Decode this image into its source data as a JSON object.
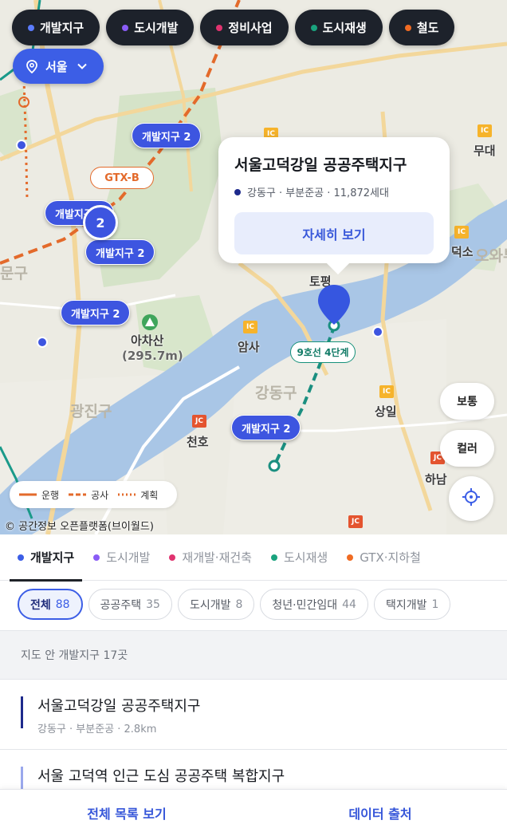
{
  "filter_bar": [
    {
      "label": "개발지구",
      "color": "#5b7cff"
    },
    {
      "label": "도시개발",
      "color": "#8a5cf6"
    },
    {
      "label": "정비사업",
      "color": "#e0336f"
    },
    {
      "label": "도시재생",
      "color": "#1aa37e"
    },
    {
      "label": "철도",
      "color": "#f06b23"
    }
  ],
  "region": {
    "label": "서울"
  },
  "map": {
    "markers": {
      "m1": "개발지구 2",
      "m2": "개발지구 2",
      "m3": "개발지구 2",
      "m4": "개발지구 2",
      "m5": "개발지구 2"
    },
    "cluster_count": "2",
    "gtx_label": "GTX-B",
    "line9_label": "9호선 4단계",
    "place_labels": {
      "mountain": "아차산",
      "mountain_height": "(295.7m)",
      "amsa": "암사",
      "sangil": "상일",
      "cheonho": "천호",
      "hanam": "하남",
      "muddae": "무대",
      "deokso": "덕소",
      "topyeong": "토평",
      "gwangjin": "광진구",
      "gangdong": "강동구",
      "road_right": "오와부",
      "gu_fragment": "문구"
    },
    "ic_labels": {
      "ic": "IC",
      "jc": "JC"
    },
    "legend": [
      {
        "label": "운행",
        "color": "#e36a2b",
        "style": "solid"
      },
      {
        "label": "공사",
        "color": "#e36a2b",
        "style": "dashed"
      },
      {
        "label": "계획",
        "color": "#e36a2b",
        "style": "dotted"
      }
    ],
    "copyright": "© 공간정보 오픈플랫폼(브이월드)",
    "side_buttons": {
      "normal": "보통",
      "color": "컬러"
    }
  },
  "callout": {
    "title": "서울고덕강일 공공주택지구",
    "district": "강동구",
    "status": "부분준공",
    "households": "11,872세대",
    "meta_text": "강동구 · 부분준공 · 11,872세대",
    "button": "자세히 보기"
  },
  "category_tabs": [
    {
      "label": "개발지구",
      "color": "#3c5ee6",
      "active": true
    },
    {
      "label": "도시개발",
      "color": "#8a5cf6",
      "active": false
    },
    {
      "label": "재개발·재건축",
      "color": "#e0336f",
      "active": false
    },
    {
      "label": "도시재생",
      "color": "#1aa37e",
      "active": false
    },
    {
      "label": "GTX·지하철",
      "color": "#f06b23",
      "active": false
    }
  ],
  "sub_filters": [
    {
      "label": "전체",
      "count": "88",
      "active": true
    },
    {
      "label": "공공주택",
      "count": "35",
      "active": false
    },
    {
      "label": "도시개발",
      "count": "8",
      "active": false
    },
    {
      "label": "청년·민간임대",
      "count": "44",
      "active": false
    },
    {
      "label": "택지개발",
      "count": "1",
      "active": false
    }
  ],
  "list_header": "지도 안 개발지구 17곳",
  "list_items": [
    {
      "title": "서울고덕강일 공공주택지구",
      "meta": "강동구 · 부분준공 · 2.8km"
    },
    {
      "title": "서울 고덕역 인근 도심 공공주택 복합지구",
      "meta": ""
    }
  ],
  "bottom_bar": {
    "list_all": "전체 목록 보기",
    "data_source": "데이터 출처"
  }
}
